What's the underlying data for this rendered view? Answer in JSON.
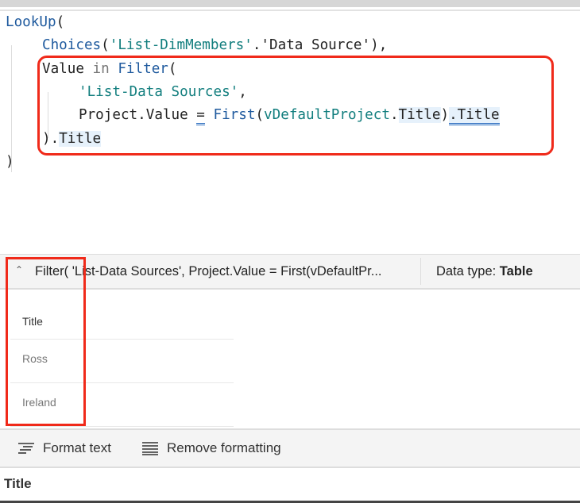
{
  "editor": {
    "lines": [
      {
        "indent": 0,
        "tokens": [
          {
            "t": "LookUp",
            "k": "fn"
          },
          {
            "t": "(",
            "k": ""
          }
        ]
      },
      {
        "indent": 1,
        "tokens": [
          {
            "t": "Choices",
            "k": "fn"
          },
          {
            "t": "(",
            "k": ""
          },
          {
            "t": "'List-DimMembers'",
            "k": "str"
          },
          {
            "t": ".'Data Source'",
            "k": ""
          },
          {
            "t": "),",
            "k": ""
          }
        ]
      },
      {
        "indent": 1,
        "tokens": [
          {
            "t": "Value",
            "k": ""
          },
          {
            "t": " in ",
            "k": "kw"
          },
          {
            "t": "Filter",
            "k": "fn"
          },
          {
            "t": "(",
            "k": ""
          }
        ]
      },
      {
        "indent": 2,
        "tokens": [
          {
            "t": "'List-Data Sources'",
            "k": "str"
          },
          {
            "t": ",",
            "k": ""
          }
        ]
      },
      {
        "indent": 2,
        "tokens": [
          {
            "t": "Project.Value ",
            "k": ""
          },
          {
            "t": "=",
            "k": "ul"
          },
          {
            "t": " ",
            "k": ""
          },
          {
            "t": "First",
            "k": "fn"
          },
          {
            "t": "(",
            "k": ""
          },
          {
            "t": "vDefaultProject",
            "k": "id"
          },
          {
            "t": ".",
            "k": ""
          },
          {
            "t": "Title",
            "k": "hl"
          },
          {
            "t": ")",
            "k": ""
          },
          {
            "t": ".Title",
            "k": "hl ul"
          }
        ]
      },
      {
        "indent": 1,
        "tokens": [
          {
            "t": ").",
            "k": ""
          },
          {
            "t": "Title",
            "k": "hl"
          }
        ]
      },
      {
        "indent": 0,
        "tokens": [
          {
            "t": ")",
            "k": ""
          }
        ]
      }
    ]
  },
  "result": {
    "expression": "Filter( 'List-Data Sources', Project.Value = First(vDefaultPr...",
    "data_type_label": "Data type: ",
    "data_type_value": "Table",
    "table": {
      "header": "Title",
      "rows": [
        "Ross",
        "Ireland"
      ]
    }
  },
  "format_bar": {
    "format_text": "Format text",
    "remove_formatting": "Remove formatting"
  },
  "bottom": {
    "label": "Title"
  },
  "colors": {
    "highlight_border": "#f02a1a",
    "function": "#1f5a9e",
    "string": "#127e7e"
  }
}
